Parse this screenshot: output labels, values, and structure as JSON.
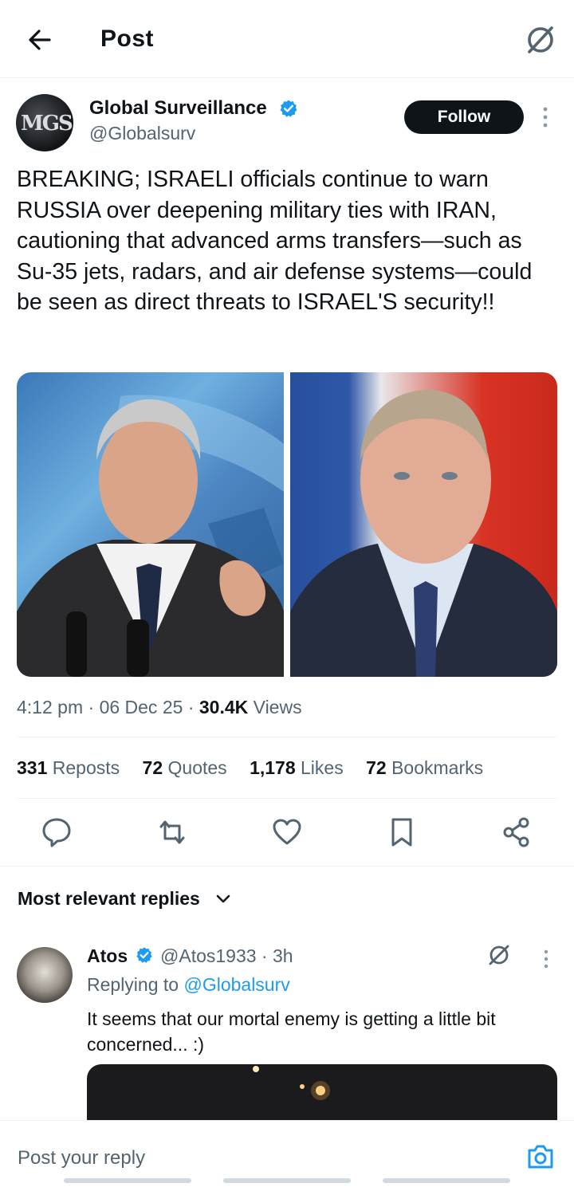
{
  "header": {
    "title": "Post"
  },
  "post": {
    "author": {
      "name": "Global Surveillance",
      "handle": "@Globalsurv",
      "avatar_text": "MGS",
      "verified": true
    },
    "follow_label": "Follow",
    "text": "BREAKING; ISRAELI officials continue to warn RUSSIA over deepening military ties with IRAN, cautioning that advanced arms transfers—such as Su-35 jets, radars, and air defense systems—could be seen as direct threats to ISRAEL'S security!!",
    "time": "4:12 pm",
    "date": "06 Dec 25",
    "views_count": "30.4K",
    "views_label": "Views",
    "stats": {
      "reposts": {
        "count": "331",
        "label": "Reposts"
      },
      "quotes": {
        "count": "72",
        "label": "Quotes"
      },
      "likes": {
        "count": "1,178",
        "label": "Likes"
      },
      "bookmarks": {
        "count": "72",
        "label": "Bookmarks"
      }
    },
    "actions": [
      "reply-icon",
      "repost-icon",
      "like-icon",
      "bookmark-icon",
      "share-icon"
    ]
  },
  "replies_filter": {
    "label": "Most relevant replies"
  },
  "reply": {
    "name": "Atos",
    "handle": "@Atos1933",
    "time": "3h",
    "replying_prefix": "Replying to",
    "replying_to": "@Globalsurv",
    "text": "It seems that our mortal enemy is getting a little bit concerned... :)"
  },
  "composer": {
    "placeholder": "Post your reply"
  },
  "colors": {
    "accent": "#1d9bf0",
    "text": "#0f1419",
    "secondary": "#536471",
    "follow_bg": "#0f1419"
  }
}
